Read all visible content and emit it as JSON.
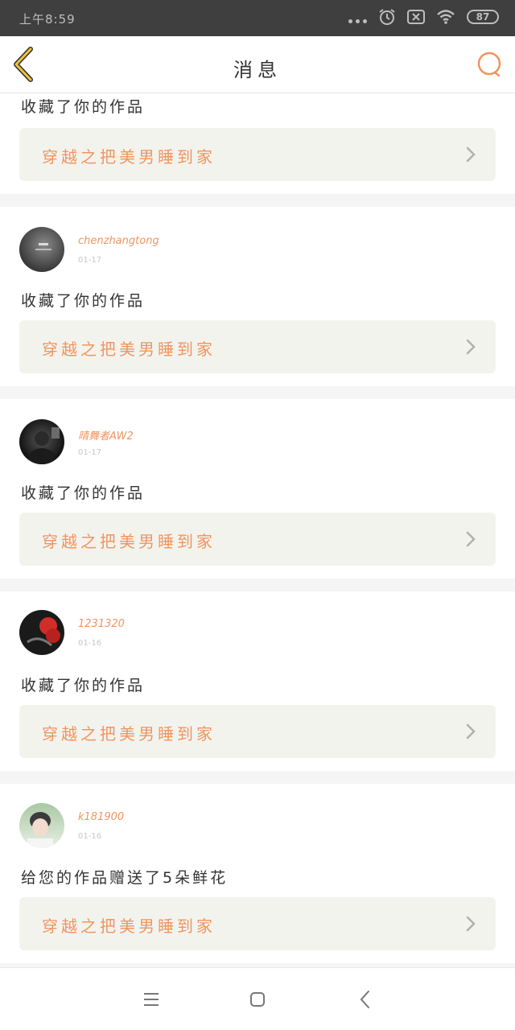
{
  "status_bar": {
    "time": "上午8:59",
    "battery": "87"
  },
  "nav": {
    "title": "消息"
  },
  "colors": {
    "accent": "#f09560",
    "card_bg": "#f3f3ee",
    "status_bar": "#3f3f3f"
  },
  "first_card": {
    "message": "收藏了你的作品",
    "work_title": "穿越之把美男睡到家"
  },
  "notifications": [
    {
      "username": "chenzhangtong",
      "date": "01-17",
      "message": "收藏了你的作品",
      "work_title": "穿越之把美男睡到家"
    },
    {
      "username": "晴舞者AW2",
      "date": "01-17",
      "message": "收藏了你的作品",
      "work_title": "穿越之把美男睡到家"
    },
    {
      "username": "1231320",
      "date": "01-16",
      "message": "收藏了你的作品",
      "work_title": "穿越之把美男睡到家"
    },
    {
      "username": "k181900",
      "date": "01-16",
      "message": "给您的作品赠送了5朵鲜花",
      "work_title": "穿越之把美男睡到家"
    }
  ],
  "icons": {
    "back": "chevron-left-icon",
    "search": "search-icon",
    "menu": "menu-icon",
    "home": "home-square-icon",
    "back_sys": "back-triangle-icon"
  }
}
